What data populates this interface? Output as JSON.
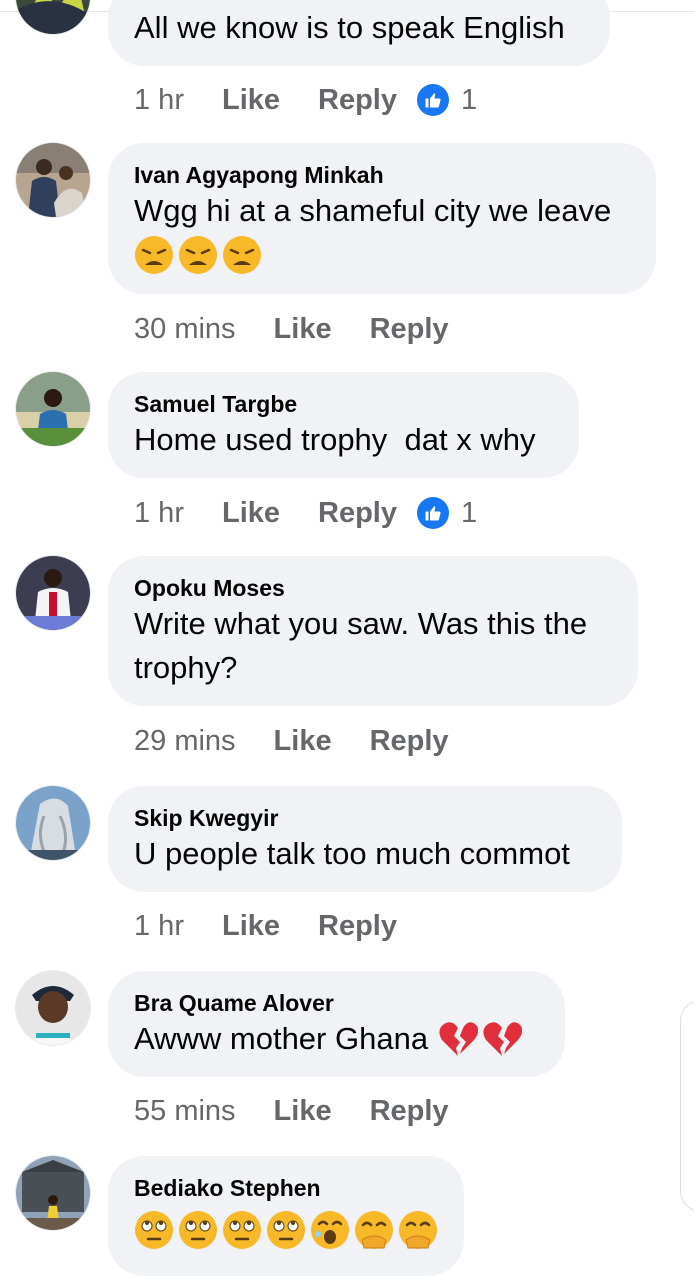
{
  "comments": [
    {
      "author": "",
      "text": "All we know is to speak English",
      "time": "1 hr",
      "like": "Like",
      "reply": "Reply",
      "reactions": "1",
      "emoji": []
    },
    {
      "author": "Ivan Agyapong Minkah",
      "text": "Wgg hi at a shameful city we leave",
      "time": "30 mins",
      "like": "Like",
      "reply": "Reply",
      "reactions": "",
      "emoji": [
        "weary-face",
        "weary-face",
        "weary-face"
      ]
    },
    {
      "author": "Samuel Targbe",
      "text": "Home used trophy  dat x why",
      "time": "1 hr",
      "like": "Like",
      "reply": "Reply",
      "reactions": "1",
      "emoji": []
    },
    {
      "author": "Opoku Moses",
      "text": "Write what you saw. Was this the trophy?",
      "time": "29 mins",
      "like": "Like",
      "reply": "Reply",
      "reactions": "",
      "emoji": []
    },
    {
      "author": "Skip Kwegyir",
      "text": "U people talk too much commot",
      "time": "1 hr",
      "like": "Like",
      "reply": "Reply",
      "reactions": "",
      "emoji": []
    },
    {
      "author": "Bra Quame Alover",
      "text": "Awww mother Ghana",
      "time": "55 mins",
      "like": "Like",
      "reply": "Reply",
      "reactions": "",
      "emoji": [
        "broken-heart",
        "broken-heart"
      ]
    },
    {
      "author": "Bediako Stephen",
      "text": "",
      "time": "",
      "like": "",
      "reply": "",
      "reactions": "",
      "emoji": [
        "face-with-rolling-eyes",
        "face-with-rolling-eyes",
        "face-with-rolling-eyes",
        "face-with-rolling-eyes",
        "yawning-face",
        "face-with-hand-over-mouth",
        "face-with-hand-over-mouth"
      ]
    }
  ],
  "colors": {
    "bubble": "#f0f2f5",
    "meta": "#65676b",
    "like_blue": "#1877f2",
    "emoji_yellow": "#f7b928",
    "broken_heart": "#e02f3a"
  },
  "icons": {
    "like_reaction": "thumbs-up-icon"
  }
}
